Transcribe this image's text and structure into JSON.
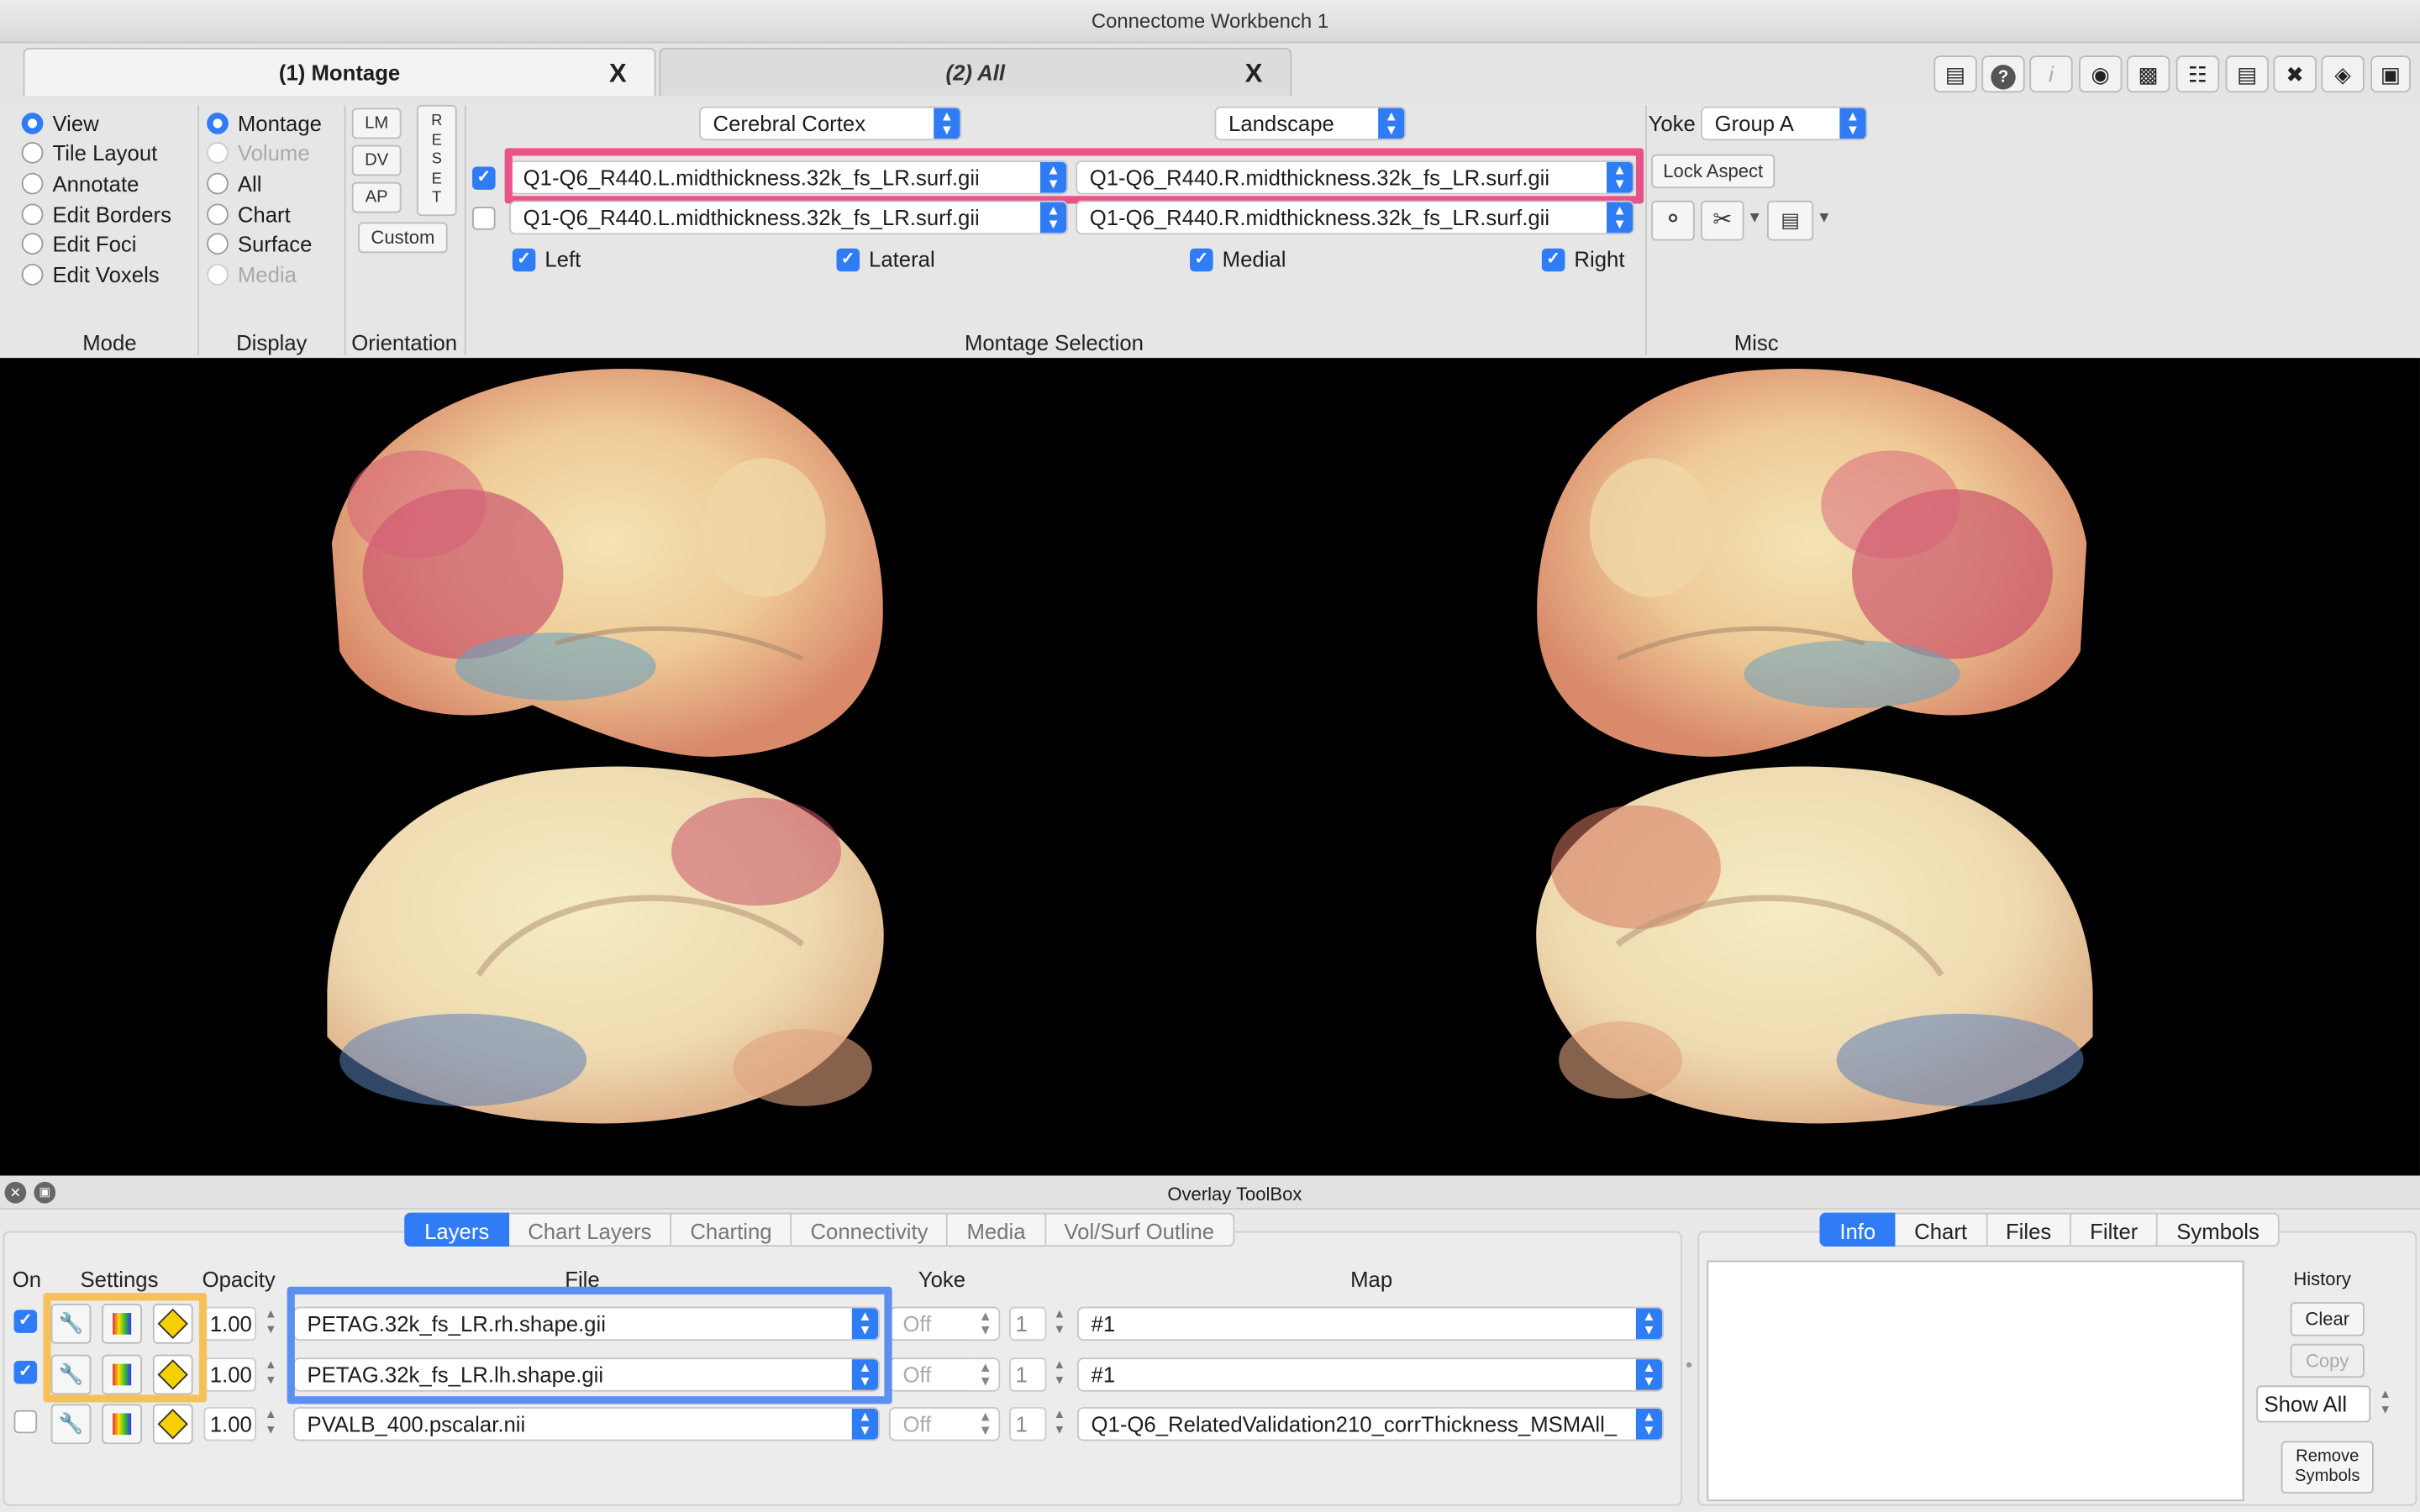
{
  "window": {
    "title": "Connectome Workbench 1"
  },
  "tabs": [
    {
      "label": "(1) Montage",
      "close": "X"
    },
    {
      "label": "(2) All",
      "close": "X"
    }
  ],
  "toolbar_icons": [
    "annotation-icon",
    "help-icon",
    "info-icon",
    "identify-icon",
    "movie-icon",
    "scene-icon",
    "clapper-icon",
    "tools-icon",
    "layers-icon",
    "toolbox-icon"
  ],
  "mode": {
    "label": "Mode",
    "options": [
      "View",
      "Tile Layout",
      "Annotate",
      "Edit Borders",
      "Edit Foci",
      "Edit Voxels"
    ],
    "selected": "View"
  },
  "display": {
    "label": "Display",
    "options": [
      "Montage",
      "Volume",
      "All",
      "Chart",
      "Surface",
      "Media"
    ],
    "disabled": [
      "Volume",
      "Media"
    ],
    "selected": "Montage"
  },
  "orientation": {
    "label": "Orientation",
    "buttons": [
      "LM",
      "DV",
      "AP"
    ],
    "reset": [
      "R",
      "E",
      "S",
      "E",
      "T"
    ],
    "custom": "Custom"
  },
  "montage": {
    "label": "Montage Selection",
    "structure": "Cerebral Cortex",
    "layout": "Landscape",
    "rows": [
      {
        "checked": true,
        "left": "Q1-Q6_R440.L.midthickness.32k_fs_LR.surf.gii",
        "right": "Q1-Q6_R440.R.midthickness.32k_fs_LR.surf.gii"
      },
      {
        "checked": false,
        "left": "Q1-Q6_R440.L.midthickness.32k_fs_LR.surf.gii",
        "right": "Q1-Q6_R440.R.midthickness.32k_fs_LR.surf.gii"
      }
    ],
    "views": [
      "Left",
      "Lateral",
      "Medial",
      "Right"
    ]
  },
  "misc": {
    "label": "Misc",
    "yoke_label": "Yoke",
    "yoke_value": "Group A",
    "lock_aspect": "Lock Aspect"
  },
  "highlight_colors": {
    "montage_row": "#e8548a",
    "settings": "#f7c15a",
    "file": "#5b8ff0"
  },
  "overlay_toolbox": {
    "title": "Overlay ToolBox",
    "tabs": [
      "Layers",
      "Chart Layers",
      "Charting",
      "Connectivity",
      "Media",
      "Vol/Surf Outline"
    ],
    "selected_tab": "Layers",
    "columns": {
      "on": "On",
      "settings": "Settings",
      "opacity": "Opacity",
      "file": "File",
      "yoke": "Yoke",
      "map": "Map"
    },
    "layers": [
      {
        "on": true,
        "opacity": "1.00",
        "file": "PETAG.32k_fs_LR.rh.shape.gii",
        "yoke": "Off",
        "map_index": "1",
        "map": "#1"
      },
      {
        "on": true,
        "opacity": "1.00",
        "file": "PETAG.32k_fs_LR.lh.shape.gii",
        "yoke": "Off",
        "map_index": "1",
        "map": "#1"
      },
      {
        "on": false,
        "opacity": "1.00",
        "file": "PVALB_400.pscalar.nii",
        "yoke": "Off",
        "map_index": "1",
        "map": "Q1-Q6_RelatedValidation210_corrThickness_MSMAll_"
      }
    ]
  },
  "info_panel": {
    "tabs": [
      "Info",
      "Chart",
      "Files",
      "Filter",
      "Symbols"
    ],
    "selected_tab": "Info",
    "history_label": "History",
    "clear": "Clear",
    "copy": "Copy",
    "show_all": "Show All",
    "remove_symbols_1": "Remove",
    "remove_symbols_2": "Symbols"
  }
}
